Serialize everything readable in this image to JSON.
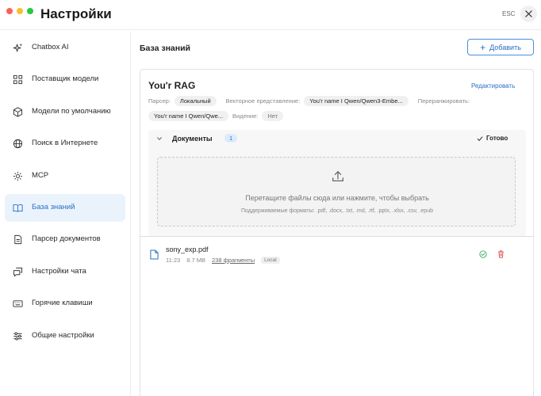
{
  "window": {
    "title": "Настройки",
    "esc_label": "ESC",
    "traffic_lights": [
      "#ff5f57",
      "#febc2e",
      "#28c840"
    ]
  },
  "sidebar": {
    "items": [
      {
        "label": "Chatbox AI",
        "icon": "sparkles-icon",
        "active": false
      },
      {
        "label": "Поставщик модели",
        "icon": "grid-icon",
        "active": false
      },
      {
        "label": "Модели по умолчанию",
        "icon": "cube-icon",
        "active": false
      },
      {
        "label": "Поиск в Интернете",
        "icon": "globe-icon",
        "active": false
      },
      {
        "label": "MCP",
        "icon": "hammer-icon",
        "active": false
      },
      {
        "label": "База знаний",
        "icon": "book-icon",
        "active": true
      },
      {
        "label": "Парсер документов",
        "icon": "document-icon",
        "active": false
      },
      {
        "label": "Настройки чата",
        "icon": "chat-bubbles-icon",
        "active": false
      },
      {
        "label": "Горячие клавиши",
        "icon": "keyboard-icon",
        "active": false
      },
      {
        "label": "Общие настройки",
        "icon": "sliders-icon",
        "active": false
      }
    ]
  },
  "main": {
    "section_title": "База знаний",
    "add_button": {
      "plus": "+",
      "label": "Добавить"
    },
    "knowledge_base": {
      "name": "You'r RAG",
      "edit_label": "Редактировать",
      "parser_label": "Парсер:",
      "parser_value": "Локальный",
      "embedding_label": "Векторное представление:",
      "embedding_value": "You'r name I Qwen/Qwen3-Embe...",
      "rerank_label": "Переранжировать:",
      "rerank_value": "You'r name I Qwen/Qwe...",
      "vision_label": "Видение:",
      "vision_value": "Нет"
    },
    "documents": {
      "title": "Документы",
      "count": "1",
      "status": "Готово",
      "dropzone_text": "Перетащите файлы сюда или нажмите, чтобы выбрать",
      "formats_text": "Поддерживаемые форматы: .pdf, .docx, .txt, .md, .rtf, .pptx, .xlsx, .csv, .epub",
      "files": [
        {
          "name": "sony_exp.pdf",
          "time": "11:23",
          "size": "8.7 MB",
          "chunks": "238 фрагменты",
          "source": "Local"
        }
      ]
    }
  },
  "colors": {
    "accent": "#2a6fc4",
    "active_bg": "#eaf3fc",
    "success": "#2faa55",
    "danger": "#e04848"
  }
}
